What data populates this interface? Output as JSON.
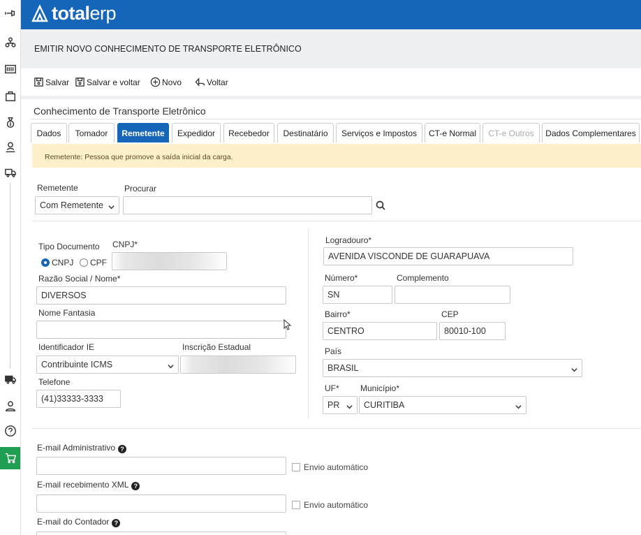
{
  "app": {
    "logo_bold": "total",
    "logo_light": "erp"
  },
  "page": {
    "title": "EMITIR NOVO CONHECIMENTO DE TRANSPORTE ELETRÔNICO"
  },
  "toolbar": {
    "save": "Salvar",
    "save_back": "Salvar e voltar",
    "new": "Novo",
    "back": "Voltar"
  },
  "section": {
    "title": "Conhecimento de Transporte Eletrônico"
  },
  "tabs": [
    {
      "label": "Dados"
    },
    {
      "label": "Tomador"
    },
    {
      "label": "Remetente"
    },
    {
      "label": "Expedidor"
    },
    {
      "label": "Recebedor"
    },
    {
      "label": "Destinatário"
    },
    {
      "label": "Serviços e Impostos"
    },
    {
      "label": "CT-e Normal"
    },
    {
      "label": "CT-e Outros"
    },
    {
      "label": "Dados Complementares"
    }
  ],
  "active_tab": "Remetente",
  "notice": "Remetente: Pessoa que promove a saída inicial da carga.",
  "form": {
    "remetente_label": "Remetente",
    "remetente_value": "Com Remetente",
    "procurar_label": "Procurar",
    "procurar_value": "",
    "tipo_doc_label": "Tipo Documento",
    "tipo_cnpj": "CNPJ",
    "tipo_cpf": "CPF",
    "cnpj_label": "CNPJ*",
    "razao_label": "Razão Social / Nome*",
    "razao_value": "DIVERSOS",
    "fantasia_label": "Nome Fantasia",
    "fantasia_value": "",
    "ie_id_label": "Identificador IE",
    "ie_id_value": "Contribuinte ICMS",
    "ie_label": "Inscrição Estadual",
    "telefone_label": "Telefone",
    "telefone_value": "(41)33333-3333",
    "logradouro_label": "Logradouro*",
    "logradouro_value": "AVENIDA VISCONDE DE GUARAPUAVA",
    "numero_label": "Número*",
    "numero_value": "SN",
    "complemento_label": "Complemento",
    "complemento_value": "",
    "bairro_label": "Bairro*",
    "bairro_value": "CENTRO",
    "cep_label": "CEP",
    "cep_value": "80010-100",
    "pais_label": "País",
    "pais_value": "BRASIL",
    "uf_label": "UF*",
    "uf_value": "PR",
    "municipio_label": "Município*",
    "municipio_value": "CURITIBA",
    "email_admin_label": "E-mail Administrativo",
    "email_xml_label": "E-mail recebimento XML",
    "email_contador_label": "E-mail do Contador",
    "envio_auto": "Envio automático",
    "help": "?"
  },
  "icons": {
    "rail": [
      "pin-icon",
      "org-icon",
      "barcode-icon",
      "bag-icon",
      "money-bag-icon",
      "person-badge-icon",
      "truck-box-icon",
      "truck-icon",
      "user-icon",
      "help-circle-icon",
      "cart-icon"
    ]
  },
  "colors": {
    "brand": "#1565b8",
    "notice_bg": "#fcf0cd",
    "cart_bg": "#1e9e50"
  }
}
